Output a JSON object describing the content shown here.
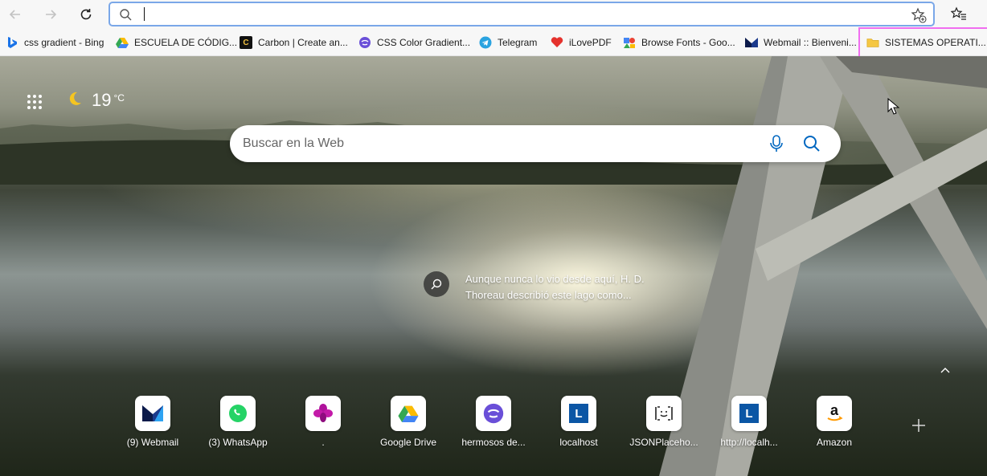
{
  "browser": {
    "address_value": "",
    "bookmarks": [
      {
        "label": "css gradient - Bing",
        "icon": "bing-icon"
      },
      {
        "label": "ESCUELA DE CÓDIG...",
        "icon": "google-drive-icon"
      },
      {
        "label": "Carbon | Create an...",
        "icon": "carbon-icon"
      },
      {
        "label": "CSS Color Gradient...",
        "icon": "gradient-icon"
      },
      {
        "label": "Telegram",
        "icon": "telegram-icon"
      },
      {
        "label": "iLovePDF",
        "icon": "ilovepdf-icon"
      },
      {
        "label": "Browse Fonts - Goo...",
        "icon": "google-fonts-icon"
      },
      {
        "label": "Webmail :: Bienveni...",
        "icon": "webmail-icon"
      },
      {
        "label": "SISTEMAS OPERATI...",
        "icon": "folder-icon"
      }
    ]
  },
  "newtab": {
    "weather": {
      "temp": "19",
      "unit": "°C",
      "icon": "moon-icon"
    },
    "search_placeholder": "Buscar en la Web",
    "caption": "Aunque nunca lo vio desde aquí, H. D. Thoreau describió este lago como...",
    "quick_links": [
      {
        "label": "(9) Webmail",
        "icon": "webmail-icon"
      },
      {
        "label": "(3) WhatsApp",
        "icon": "whatsapp-icon"
      },
      {
        "label": ".",
        "icon": "orchid-icon"
      },
      {
        "label": "Google Drive",
        "icon": "google-drive-icon"
      },
      {
        "label": "hermosos de...",
        "icon": "gradient-icon"
      },
      {
        "label": "localhost",
        "icon": "letter-l-icon"
      },
      {
        "label": "JSONPlaceho...",
        "icon": "json-icon"
      },
      {
        "label": "http://localh...",
        "icon": "letter-l-icon"
      },
      {
        "label": "Amazon",
        "icon": "amazon-icon"
      }
    ]
  },
  "colors": {
    "accent": "#0067c0",
    "highlight": "#f06ef0"
  }
}
